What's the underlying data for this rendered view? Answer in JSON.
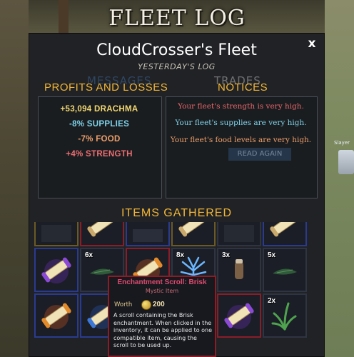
{
  "window": {
    "title": "FLEET LOG",
    "fleet_name": "CloudCrosser's Fleet",
    "subtitle": "YESTERDAY'S LOG",
    "close_glyph": "x",
    "ghost_tabs": [
      "MESSAGES",
      "TRADES"
    ],
    "ghost_button": "READ AGAIN"
  },
  "profits": {
    "heading": "PROFITS AND LOSSES",
    "lines": [
      {
        "text": "+53,094 DRACHMA",
        "color": "#f2d870"
      },
      {
        "text": "-8% SUPPLIES",
        "color": "#7fd3ea"
      },
      {
        "text": "-7% FOOD",
        "color": "#ef9f6a"
      },
      {
        "text": "+4% STRENGTH",
        "color": "#ee6f72"
      }
    ]
  },
  "notices": {
    "heading": "NOTICES",
    "lines": [
      {
        "text": "Your fleet's strength is very high.",
        "color": "#e8666a"
      },
      {
        "text": "Your fleet's supplies are very high.",
        "color": "#7fd3ea"
      },
      {
        "text": "Your fleet's food levels are very high.",
        "color": "#ef9f6a"
      }
    ]
  },
  "items": {
    "heading": "ITEMS GATHERED",
    "slots": [
      {
        "icon": "dark-item-icon",
        "rarity": "gold",
        "count": ""
      },
      {
        "icon": "scroll-icon",
        "rarity": "epic",
        "count": ""
      },
      {
        "icon": "sparkle-item-icon",
        "rarity": "rare",
        "count": ""
      },
      {
        "icon": "scroll-icon",
        "rarity": "gold",
        "count": ""
      },
      {
        "icon": "dark-item-icon",
        "rarity": "common",
        "count": ""
      },
      {
        "icon": "scroll-icon",
        "rarity": "rare",
        "count": ""
      },
      {
        "icon": "purple-scroll-icon",
        "rarity": "rare",
        "count": ""
      },
      {
        "icon": "herb-icon",
        "rarity": "common",
        "count": "6x"
      },
      {
        "icon": "orange-scroll-icon",
        "rarity": "epic",
        "count": ""
      },
      {
        "icon": "blue-flower-icon",
        "rarity": "common",
        "count": "8x"
      },
      {
        "icon": "jar-icon",
        "rarity": "common",
        "count": "3x"
      },
      {
        "icon": "herb-icon",
        "rarity": "common",
        "count": "5x"
      },
      {
        "icon": "orange-scroll-icon",
        "rarity": "rare",
        "count": ""
      },
      {
        "icon": "blue-scroll-icon",
        "rarity": "rare",
        "count": ""
      },
      {
        "icon": "scroll-icon",
        "rarity": "common",
        "count": ""
      },
      {
        "icon": "scroll-icon",
        "rarity": "common",
        "count": ""
      },
      {
        "icon": "purple-scroll-icon",
        "rarity": "epic",
        "count": ""
      },
      {
        "icon": "grass-icon",
        "rarity": "common",
        "count": "2x"
      }
    ]
  },
  "tooltip": {
    "name": "Enchantment Scroll: Brisk",
    "type": "Mystic Item",
    "worth_label": "Worth",
    "worth_value": "200",
    "description": "A scroll containing the Brisk enchantment. When clicked in the inventory, it can be applied to one compatible item, causing the scroll to be used up."
  },
  "background": {
    "npc_name": "Slayer"
  }
}
